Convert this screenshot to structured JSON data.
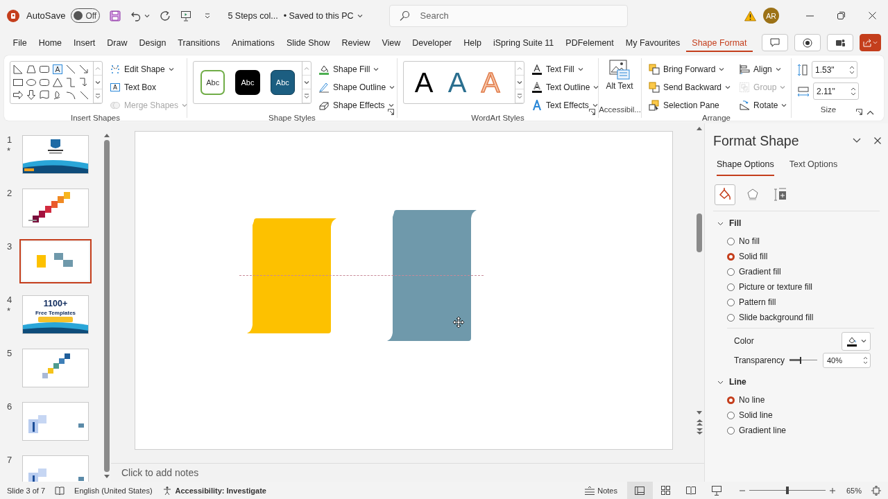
{
  "title_bar": {
    "autosave_label": "AutoSave",
    "autosave_toggle": {
      "label": "Off",
      "on": false
    },
    "document_title": "5 Steps col...",
    "save_status": "• Saved to this PC",
    "search": {
      "placeholder": "Search"
    },
    "avatar": "AR"
  },
  "tabs": [
    {
      "label": "File",
      "selected": false
    },
    {
      "label": "Home",
      "selected": false
    },
    {
      "label": "Insert",
      "selected": false
    },
    {
      "label": "Draw",
      "selected": false
    },
    {
      "label": "Design",
      "selected": false
    },
    {
      "label": "Transitions",
      "selected": false
    },
    {
      "label": "Animations",
      "selected": false
    },
    {
      "label": "Slide Show",
      "selected": false
    },
    {
      "label": "Review",
      "selected": false
    },
    {
      "label": "View",
      "selected": false
    },
    {
      "label": "Developer",
      "selected": false
    },
    {
      "label": "Help",
      "selected": false
    },
    {
      "label": "iSpring Suite 11",
      "selected": false
    },
    {
      "label": "PDFelement",
      "selected": false
    },
    {
      "label": "My Favourites",
      "selected": false
    },
    {
      "label": "Shape Format",
      "selected": true
    }
  ],
  "ribbon": {
    "insert_shapes": {
      "title": "Insert Shapes",
      "commands": [
        {
          "label": "Edit Shape",
          "disabled": false,
          "dropdown": true
        },
        {
          "label": "Text Box",
          "disabled": false,
          "dropdown": false
        },
        {
          "label": "Merge Shapes",
          "disabled": true,
          "dropdown": true
        }
      ]
    },
    "shape_styles": {
      "title": "Shape Styles",
      "presets": [
        {
          "label": "Abc",
          "kind": "outline"
        },
        {
          "label": "Abc",
          "kind": "dark"
        },
        {
          "label": "Abc",
          "kind": "accent"
        }
      ],
      "commands": [
        {
          "label": "Shape Fill",
          "disabled": false,
          "dropdown": true
        },
        {
          "label": "Shape Outline",
          "disabled": false,
          "dropdown": true
        },
        {
          "label": "Shape Effects",
          "disabled": false,
          "dropdown": true
        }
      ]
    },
    "wordart_styles": {
      "title": "WordArt Styles",
      "presets": [
        {
          "label": "A",
          "kind": "solid"
        },
        {
          "label": "A",
          "kind": "accent"
        },
        {
          "label": "A",
          "kind": "outline"
        }
      ],
      "commands": [
        {
          "label": "Text Fill",
          "disabled": false,
          "dropdown": true
        },
        {
          "label": "Text Outline",
          "disabled": false,
          "dropdown": true
        },
        {
          "label": "Text Effects",
          "disabled": false,
          "dropdown": true
        }
      ]
    },
    "accessibility": {
      "title": "Accessibil...",
      "command": "Alt Text"
    },
    "arrange": {
      "title": "Arrange",
      "commands": [
        {
          "label": "Bring Forward",
          "disabled": false,
          "dropdown": true
        },
        {
          "label": "Send Backward",
          "disabled": false,
          "dropdown": true
        },
        {
          "label": "Selection Pane",
          "disabled": false,
          "dropdown": false
        },
        {
          "label": "Align",
          "disabled": false,
          "dropdown": true
        },
        {
          "label": "Group",
          "disabled": true,
          "dropdown": true
        },
        {
          "label": "Rotate",
          "disabled": false,
          "dropdown": true
        }
      ]
    },
    "size": {
      "title": "Size",
      "height": "1.53\"",
      "width": "2.11\""
    }
  },
  "slides": [
    {
      "number": "1",
      "mark": "*",
      "kind": "title",
      "selected": false
    },
    {
      "number": "2",
      "kind": "steps",
      "selected": false
    },
    {
      "number": "3",
      "kind": "shapes",
      "selected": true
    },
    {
      "number": "4",
      "mark": "*",
      "kind": "promo",
      "texts": [
        "1100+",
        "Free Templates"
      ],
      "selected": false
    },
    {
      "number": "5",
      "kind": "stairs",
      "selected": false
    },
    {
      "number": "6",
      "kind": "blocks",
      "selected": false
    },
    {
      "number": "7",
      "kind": "blocks",
      "selected": false
    }
  ],
  "slide": {
    "shapes": [
      {
        "color": "#fdc100"
      },
      {
        "color": "#6f99ab"
      }
    ]
  },
  "notes": {
    "placeholder": "Click to add notes"
  },
  "format_pane": {
    "title": "Format Shape",
    "tabs": [
      {
        "label": "Shape Options",
        "selected": true
      },
      {
        "label": "Text Options",
        "selected": false
      }
    ],
    "icon_tabs": [
      {
        "kind": "fill",
        "selected": true
      },
      {
        "kind": "effects",
        "selected": false
      },
      {
        "kind": "size",
        "selected": false
      }
    ],
    "sections": [
      {
        "title": "Fill",
        "expanded": true,
        "options": [
          {
            "label": "No fill",
            "selected": false
          },
          {
            "label": "Solid fill",
            "selected": true
          },
          {
            "label": "Gradient fill",
            "selected": false
          },
          {
            "label": "Picture or texture fill",
            "selected": false
          },
          {
            "label": "Pattern fill",
            "selected": false
          },
          {
            "label": "Slide background fill",
            "selected": false
          }
        ],
        "color_label": "Color",
        "transparency": {
          "label": "Transparency",
          "level": 0.4,
          "value": "40%"
        }
      },
      {
        "title": "Line",
        "expanded": true,
        "options": [
          {
            "label": "No line",
            "selected": true
          },
          {
            "label": "Solid line",
            "selected": false
          },
          {
            "label": "Gradient line",
            "selected": false
          }
        ]
      }
    ]
  },
  "status_bar": {
    "slide_info": "Slide 3 of 7",
    "language": "English (United States)",
    "accessibility": "Accessibility: Investigate",
    "notes_button": "Notes",
    "zoom": {
      "level": 0.5,
      "value": "65%"
    }
  }
}
